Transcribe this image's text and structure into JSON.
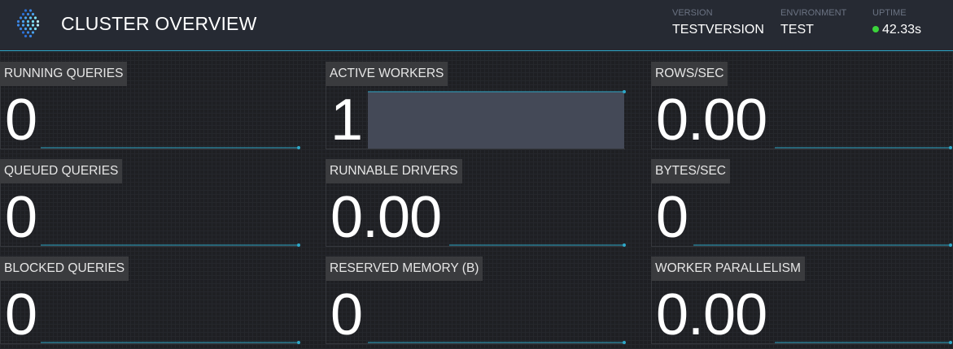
{
  "header": {
    "title": "CLUSTER OVERVIEW",
    "version_label": "VERSION",
    "version_value": "TESTVERSION",
    "environment_label": "ENVIRONMENT",
    "environment_value": "TEST",
    "uptime_label": "UPTIME",
    "uptime_value": "42.33s",
    "uptime_status_color": "#3bd33b",
    "accent_color": "#2ea8c8"
  },
  "tiles": [
    {
      "label": "RUNNING QUERIES",
      "value": "0"
    },
    {
      "label": "ACTIVE WORKERS",
      "value": "1"
    },
    {
      "label": "ROWS/SEC",
      "value": "0.00"
    },
    {
      "label": "QUEUED QUERIES",
      "value": "0"
    },
    {
      "label": "RUNNABLE DRIVERS",
      "value": "0.00"
    },
    {
      "label": "BYTES/SEC",
      "value": "0"
    },
    {
      "label": "BLOCKED QUERIES",
      "value": "0"
    },
    {
      "label": "RESERVED MEMORY (B)",
      "value": "0"
    },
    {
      "label": "WORKER PARALLELISM",
      "value": "0.00"
    }
  ]
}
